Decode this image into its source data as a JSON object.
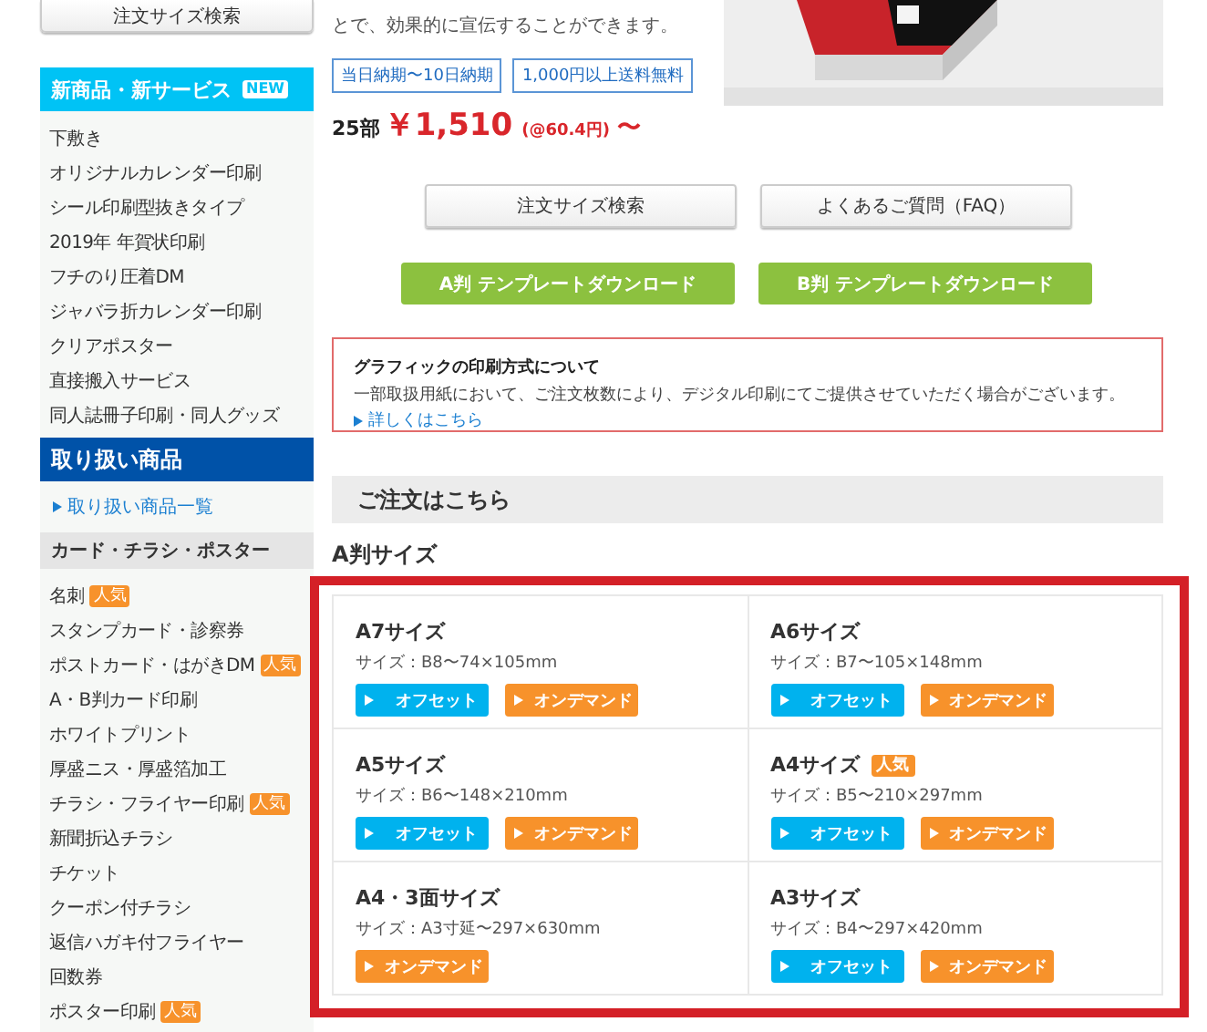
{
  "sidebar": {
    "search_button": "注文サイズ検索",
    "new_services": {
      "title": "新商品・新サービス",
      "badge": "NEW",
      "items": [
        "下敷き",
        "オリジナルカレンダー印刷",
        "シール印刷型抜きタイプ",
        "2019年 年賀状印刷",
        "フチのり圧着DM",
        "ジャバラ折カレンダー印刷",
        "クリアポスター",
        "直接搬入サービス",
        "同人誌冊子印刷・同人グッズ"
      ]
    },
    "products": {
      "title": "取り扱い商品",
      "link": "取り扱い商品一覧"
    },
    "category": {
      "title": "カード・チラシ・ポスター",
      "items": [
        {
          "label": "名刺",
          "badge": "人気"
        },
        {
          "label": "スタンプカード・診察券"
        },
        {
          "label": "ポストカード・はがきDM",
          "badge": "人気"
        },
        {
          "label": "A・B判カード印刷"
        },
        {
          "label": "ホワイトプリント"
        },
        {
          "label": "厚盛ニス・厚盛箔加工"
        },
        {
          "label": "チラシ・フライヤー印刷",
          "badge": "人気"
        },
        {
          "label": "新聞折込チラシ"
        },
        {
          "label": "チケット"
        },
        {
          "label": "クーポン付チラシ"
        },
        {
          "label": "返信ハガキ付フライヤー"
        },
        {
          "label": "回数券"
        },
        {
          "label": "ポスター印刷",
          "badge": "人気"
        }
      ]
    }
  },
  "main": {
    "intro": "とで、効果的に宣伝することができます。",
    "tags": [
      "当日納期〜10日納期",
      "1,000円以上送料無料"
    ],
    "price": {
      "quantity": "25部",
      "amount": "￥1,510",
      "unit_price": "(@60.4円)",
      "suffix": "〜"
    },
    "buttons": [
      "注文サイズ検索",
      "よくあるご質問（FAQ）"
    ],
    "template_buttons": [
      "A判 テンプレートダウンロード",
      "B判 テンプレートダウンロード"
    ],
    "notice": {
      "title": "グラフィックの印刷方式について",
      "body": "一部取扱用紙において、ご注文枚数により、デジタル印刷にてご提供させていただく場合がございます。",
      "link": "詳しくはこちら"
    },
    "order_heading": "ご注文はこちら",
    "size_group_title": "A判サイズ",
    "sizes": [
      {
        "name": "A7サイズ",
        "spec": "サイズ：B8〜74×105mm",
        "methods": [
          {
            "kind": "offset",
            "label": "オフセット"
          },
          {
            "kind": "ondemand",
            "label": "オンデマンド"
          }
        ]
      },
      {
        "name": "A6サイズ",
        "spec": "サイズ：B7〜105×148mm",
        "methods": [
          {
            "kind": "offset",
            "label": "オフセット"
          },
          {
            "kind": "ondemand",
            "label": "オンデマンド"
          }
        ]
      },
      {
        "name": "A5サイズ",
        "spec": "サイズ：B6〜148×210mm",
        "methods": [
          {
            "kind": "offset",
            "label": "オフセット"
          },
          {
            "kind": "ondemand",
            "label": "オンデマンド"
          }
        ]
      },
      {
        "name": "A4サイズ",
        "badge": "人気",
        "spec": "サイズ：B5〜210×297mm",
        "methods": [
          {
            "kind": "offset",
            "label": "オフセット"
          },
          {
            "kind": "ondemand",
            "label": "オンデマンド"
          }
        ]
      },
      {
        "name": "A4・3面サイズ",
        "spec": "サイズ：A3寸延〜297×630mm",
        "methods": [
          {
            "kind": "ondemand",
            "label": "オンデマンド"
          }
        ]
      },
      {
        "name": "A3サイズ",
        "spec": "サイズ：B4〜297×420mm",
        "methods": [
          {
            "kind": "offset",
            "label": "オフセット"
          },
          {
            "kind": "ondemand",
            "label": "オンデマンド"
          }
        ]
      }
    ]
  }
}
